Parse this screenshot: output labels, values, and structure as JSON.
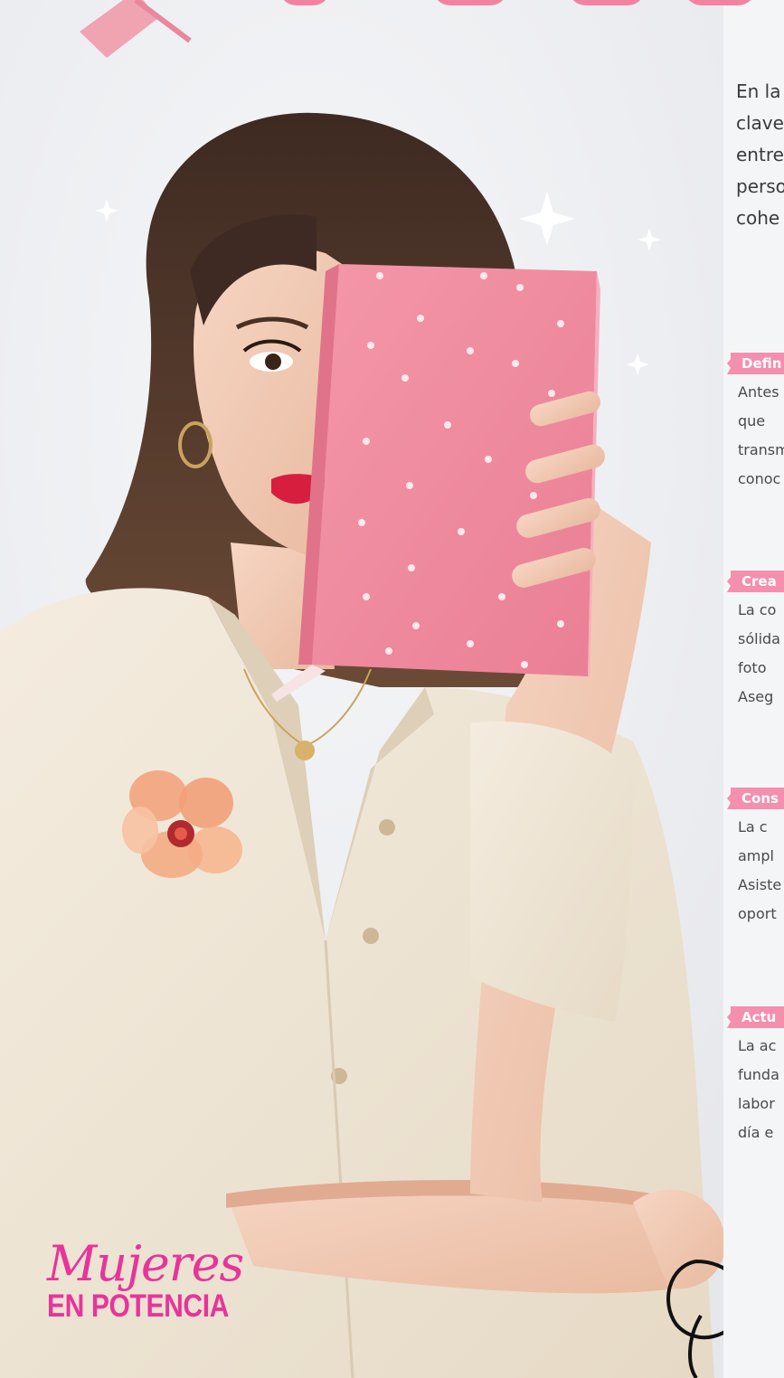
{
  "intro": {
    "lines": [
      "En la",
      "clave",
      "entre",
      "perso",
      "cohe"
    ]
  },
  "sections": [
    {
      "heading": "Defin",
      "lines": [
        "Antes",
        "que",
        "transm",
        "conoc"
      ]
    },
    {
      "heading": "Crea",
      "lines": [
        "La co",
        "sólida",
        "foto",
        "Aseg"
      ]
    },
    {
      "heading": "Cons",
      "lines": [
        "La c",
        "ampl",
        "Asiste",
        "oport"
      ]
    },
    {
      "heading": "Actu",
      "lines": [
        "La ac",
        "funda",
        "labor",
        "día e"
      ]
    }
  ],
  "logo": {
    "script": "Mujeres",
    "block": "EN POTENCIA"
  },
  "colors": {
    "accent_pink": "#f48fae",
    "logo_magenta": "#e8349a",
    "notebook_pink": "#f08a9e",
    "shirt_cream": "#efe6d6",
    "hair_brown": "#4a3328"
  }
}
